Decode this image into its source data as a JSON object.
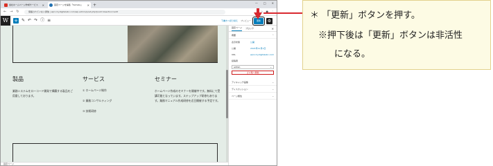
{
  "browser": {
    "tabs": [
      {
        "label": "会社ホームページ作成サービス",
        "active": false
      },
      {
        "label": "固定ページを編集「Sample」",
        "active": true
      }
    ],
    "window_controls": [
      "—",
      "□",
      "✕"
    ],
    "url": "保護されていない通信 | wp1.mydigitalabc.com/wp-admin/post.php?post=1&action=edit"
  },
  "wp_toolbar": {
    "switch_draft_label": "下書きへ切り替え",
    "preview_label": "プレビュー",
    "update_label": "更新"
  },
  "page": {
    "columns": [
      {
        "heading": "製品",
        "text": "業務システムをローコード開発で構築する製品をご用意しております。"
      },
      {
        "heading": "サービス",
        "items": [
          "① ホームページ制作",
          "② 業務コンサルティング",
          "③ 技術研修"
        ]
      },
      {
        "heading": "セミナー",
        "text": "ホームページ作成のセミナーを開催中です。無料にて受講可能となっています。ステップアップ研修もあります。業務マニュアル作成研修を近日開催する予定です。"
      }
    ],
    "status_text": "固定ページ"
  },
  "sidebar": {
    "tabs": [
      "固定ページ",
      "ブロック"
    ],
    "sections": {
      "status": "概要",
      "rows": [
        {
          "key": "表示状態",
          "value": "公開"
        },
        {
          "key": "公開",
          "value": "2021年11月1日"
        },
        {
          "key": "URL",
          "value": "wp1.mydigitalabc.com"
        },
        {
          "key": "投稿者",
          "value": ""
        }
      ],
      "author_value": "admin",
      "trash_label": "ゴミ箱へ移動",
      "collapsed": [
        "アイキャッチ画像",
        "ディスカッション",
        "ページ属性"
      ]
    }
  },
  "callout": {
    "line1": "＊ 「更新」ボタンを押す。",
    "line2": "※押下後は「更新」ボタンは非活性",
    "line3": "になる。"
  },
  "colors": {
    "accent": "#007cba",
    "annotation": "#d8282f",
    "canvas": "#e4ede7",
    "callout_bg": "#fdfbe4"
  }
}
